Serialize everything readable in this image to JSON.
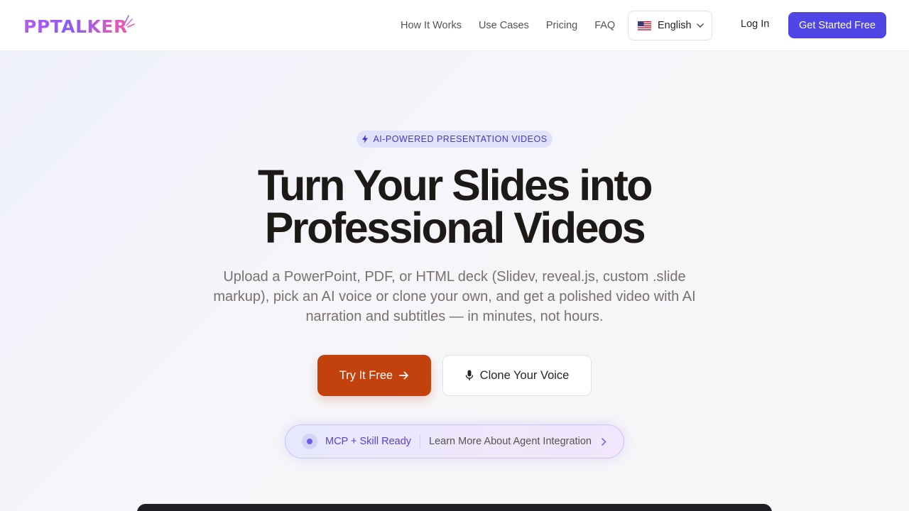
{
  "header": {
    "logo_text": "PPTALKER",
    "nav": [
      {
        "label": "How It Works"
      },
      {
        "label": "Use Cases"
      },
      {
        "label": "Pricing"
      },
      {
        "label": "FAQ"
      }
    ],
    "language": {
      "flag_icon": "us-flag-icon",
      "label": "English"
    },
    "login_label": "Log In",
    "cta_label": "Get Started Free"
  },
  "hero": {
    "badge": "AI-POWERED PRESENTATION VIDEOS",
    "title_line1": "Turn Your Slides into",
    "title_line2": "Professional Videos",
    "subtitle": "Upload a PowerPoint, PDF, or HTML deck (Slidev, reveal.js, custom .slide markup), pick an AI voice or clone your own, and get a polished video with AI narration and subtitles — in minutes, not hours.",
    "primary_button": "Try It Free",
    "secondary_button": "Clone Your Voice"
  },
  "mcp_banner": {
    "label": "MCP + Skill Ready",
    "link": "Learn More About Agent Integration"
  },
  "colors": {
    "accent": "#4f46e5",
    "primary_cta": "#c2410c",
    "badge_text": "#4338ca",
    "mcp_text": "#5b3fd1"
  }
}
